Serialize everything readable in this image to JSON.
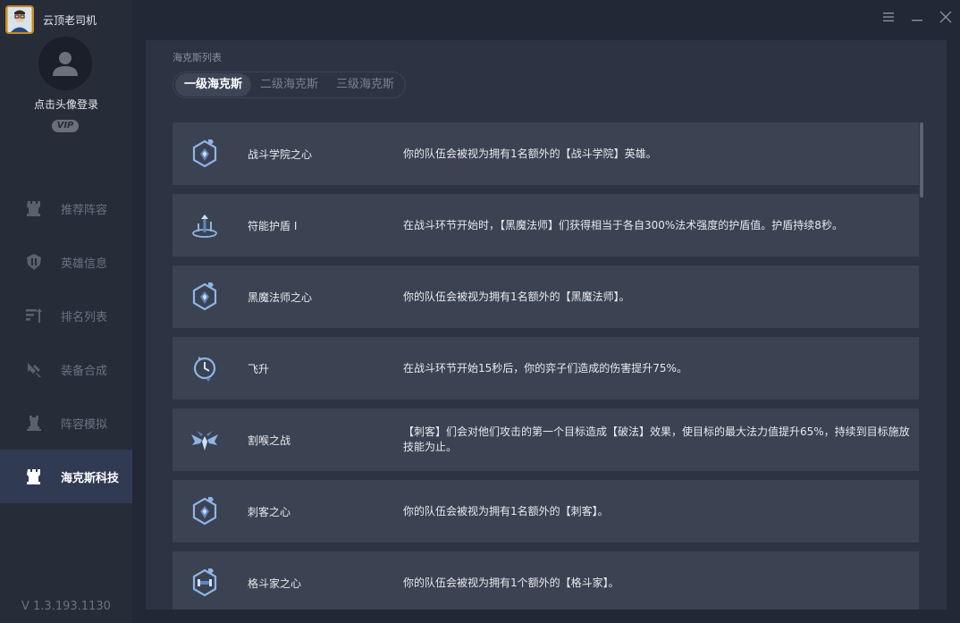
{
  "app": {
    "title": "云顶老司机"
  },
  "profile": {
    "login_text": "点击头像登录",
    "vip_label": "VIP"
  },
  "nav": {
    "items": [
      {
        "label": "推荐阵容",
        "icon": "rook-icon"
      },
      {
        "label": "英雄信息",
        "icon": "helmet-icon"
      },
      {
        "label": "排名列表",
        "icon": "ranking-icon"
      },
      {
        "label": "装备合成",
        "icon": "item-craft-icon"
      },
      {
        "label": "阵容模拟",
        "icon": "board-icon"
      },
      {
        "label": "海克斯科技",
        "icon": "rook-icon",
        "active": true
      }
    ]
  },
  "version": "V 1.3.193.1130",
  "window": {
    "menu_icon": "menu-icon",
    "minimize_icon": "minimize-icon",
    "close_icon": "close-icon"
  },
  "main": {
    "section_title": "海克斯列表",
    "tabs": [
      {
        "label": "一级海克斯",
        "active": true
      },
      {
        "label": "二级海克斯",
        "active": false
      },
      {
        "label": "三级海克斯",
        "active": false
      }
    ],
    "hextechs": [
      {
        "name": "战斗学院之心",
        "desc": "你的队伍会被视为拥有1名额外的【战斗学院】英雄。",
        "icon": "heart-crest-icon"
      },
      {
        "name": "符能护盾 I",
        "desc": "在战斗环节开始时，【黑魔法师】们获得相当于各自300%法术强度的护盾值。护盾持续8秒。",
        "icon": "shield-rune-icon"
      },
      {
        "name": "黑魔法师之心",
        "desc": "你的队伍会被视为拥有1名额外的【黑魔法师】。",
        "icon": "heart-crest-icon"
      },
      {
        "name": "飞升",
        "desc": "在战斗环节开始15秒后，你的弈子们造成的伤害提升75%。",
        "icon": "ascension-clock-icon"
      },
      {
        "name": "割喉之战",
        "desc": "【刺客】们会对他们攻击的第一个目标造成【破法】效果，使目标的最大法力值提升65%，持续到目标施放技能为止。",
        "icon": "wings-icon"
      },
      {
        "name": "刺客之心",
        "desc": "你的队伍会被视为拥有1名额外的【刺客】。",
        "icon": "heart-crest-icon"
      },
      {
        "name": "格斗家之心",
        "desc": "你的队伍会被视为拥有1个额外的【格斗家】。",
        "icon": "heart-crest-icon"
      }
    ]
  },
  "colors": {
    "accent_active": "#303a53",
    "row_bg": "#3b4251",
    "panel_bg": "#2c3342",
    "sidebar_bg": "#262c38",
    "icon_blue": "#8fb4e6"
  }
}
